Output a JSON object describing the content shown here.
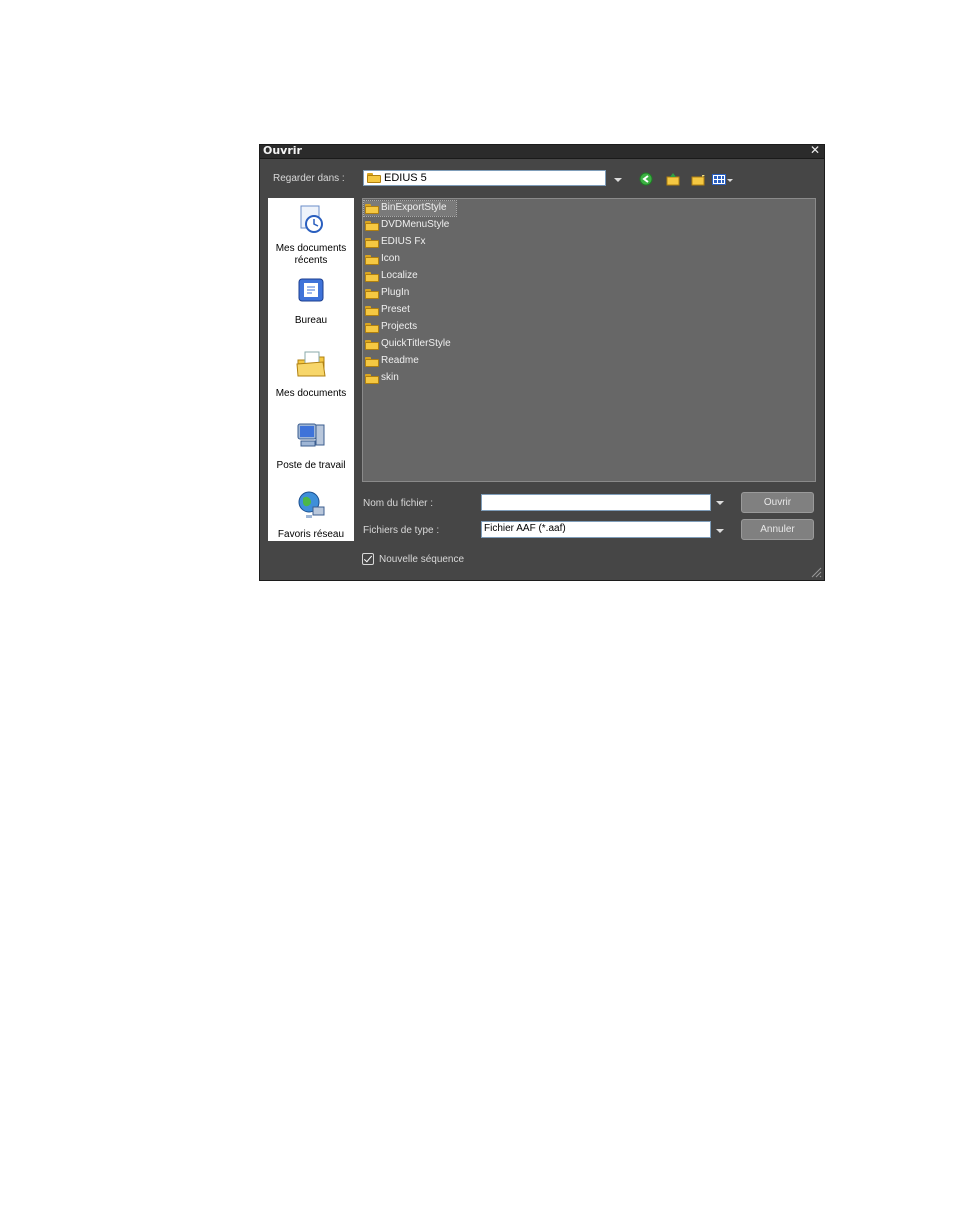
{
  "dialog": {
    "title": "Ouvrir",
    "close_symbol": "✕",
    "look_in_label": "Regarder dans :",
    "look_in_value": "EDIUS 5",
    "toolbar_icons": [
      "back-icon",
      "up-folder-icon",
      "new-folder-icon",
      "view-menu-icon"
    ]
  },
  "places": [
    {
      "label": "Mes documents récents",
      "icon": "recent-documents-icon"
    },
    {
      "label": "Bureau",
      "icon": "desktop-icon"
    },
    {
      "label": "Mes documents",
      "icon": "my-documents-icon"
    },
    {
      "label": "Poste de travail",
      "icon": "my-computer-icon"
    },
    {
      "label": "Favoris réseau",
      "icon": "network-places-icon"
    }
  ],
  "files": [
    "BinExportStyle",
    "DVDMenuStyle",
    "EDIUS Fx",
    "Icon",
    "Localize",
    "PlugIn",
    "Preset",
    "Projects",
    "QuickTitlerStyle",
    "Readme",
    "skin"
  ],
  "form": {
    "filename_label": "Nom du fichier :",
    "filename_value": "",
    "filetype_label": "Fichiers de type :",
    "filetype_value": "Fichier AAF (*.aaf)",
    "open_button": "Ouvrir",
    "cancel_button": "Annuler",
    "checkbox_label": "Nouvelle séquence",
    "checkbox_checked": true
  },
  "colors": {
    "dialog_bg": "#464646",
    "list_bg": "#676767",
    "folder_yellow": "#f5c842"
  }
}
